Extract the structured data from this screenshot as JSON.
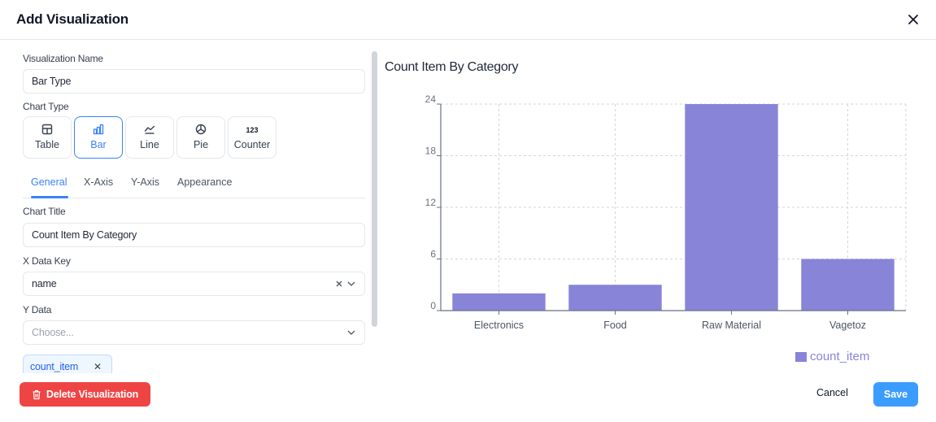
{
  "dialog": {
    "title": "Add Visualization",
    "close_icon": "close-icon"
  },
  "form": {
    "viz_name_label": "Visualization Name",
    "viz_name_value": "Bar Type",
    "chart_type_label": "Chart Type",
    "chart_types": [
      {
        "label": "Table",
        "icon": "table-icon",
        "active": false
      },
      {
        "label": "Bar",
        "icon": "bar-chart-icon",
        "active": true
      },
      {
        "label": "Line",
        "icon": "line-chart-icon",
        "active": false
      },
      {
        "label": "Pie",
        "icon": "pie-chart-icon",
        "active": false
      },
      {
        "label": "Counter",
        "icon": "counter-icon",
        "icon_text": "123",
        "active": false
      }
    ],
    "tabs": [
      {
        "label": "General",
        "active": true
      },
      {
        "label": "X-Axis",
        "active": false
      },
      {
        "label": "Y-Axis",
        "active": false
      },
      {
        "label": "Appearance",
        "active": false
      }
    ],
    "chart_title_label": "Chart Title",
    "chart_title_value": "Count Item By Category",
    "x_key_label": "X Data Key",
    "x_key_value": "name",
    "y_data_label": "Y Data",
    "y_data_placeholder": "Choose...",
    "y_data_chips": [
      "count_item"
    ]
  },
  "footer": {
    "delete_label": "Delete Visualization",
    "cancel_label": "Cancel",
    "save_label": "Save"
  },
  "colors": {
    "accent": "#3b82f6",
    "danger": "#ef4444",
    "bar": "#8884d8",
    "save": "#3b9cff"
  },
  "chart_data": {
    "type": "bar",
    "title": "Count Item By Category",
    "categories": [
      "Electronics",
      "Food",
      "Raw Material",
      "Vagetoz"
    ],
    "series": [
      {
        "name": "count_item",
        "values": [
          2,
          3,
          24,
          6
        ],
        "color": "#8884d8"
      }
    ],
    "yticks": [
      0,
      6,
      12,
      18,
      24
    ],
    "ylim": [
      0,
      24
    ],
    "xlabel": "",
    "ylabel": "",
    "grid": true,
    "legend": "bottom-right"
  }
}
